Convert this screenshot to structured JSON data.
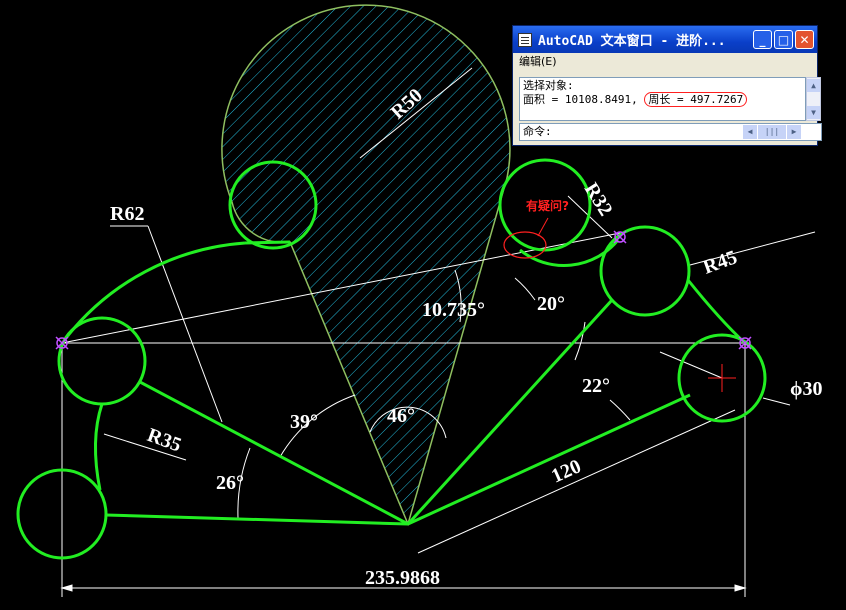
{
  "drawing": {
    "dimensions": {
      "r50": "R50",
      "r32": "R32",
      "r62": "R62",
      "r45": "R45",
      "r35": "R35",
      "angle_10": "10.735°",
      "angle_20": "20°",
      "angle_22": "22°",
      "angle_39": "39°",
      "angle_46": "46°",
      "angle_26": "26°",
      "len_120": "120",
      "phi30": "ϕ30",
      "width": "235.9868"
    },
    "annotation": "有疑问?",
    "colors": {
      "outline": "#22ff22",
      "hatch": "#22b8d8",
      "dims": "#ffffff",
      "annotation": "#ff2020"
    }
  },
  "text_window": {
    "title": "AutoCAD 文本窗口 - 进阶...",
    "menu_edit": "编辑(E)",
    "line1": "选择对象:",
    "area_text": "面积 = 10108.8491,",
    "perimeter_text": "周长 = 497.7267",
    "command_label": "命令:",
    "buttons": {
      "minimize": "_",
      "maximize": "□",
      "close": "✕"
    }
  }
}
